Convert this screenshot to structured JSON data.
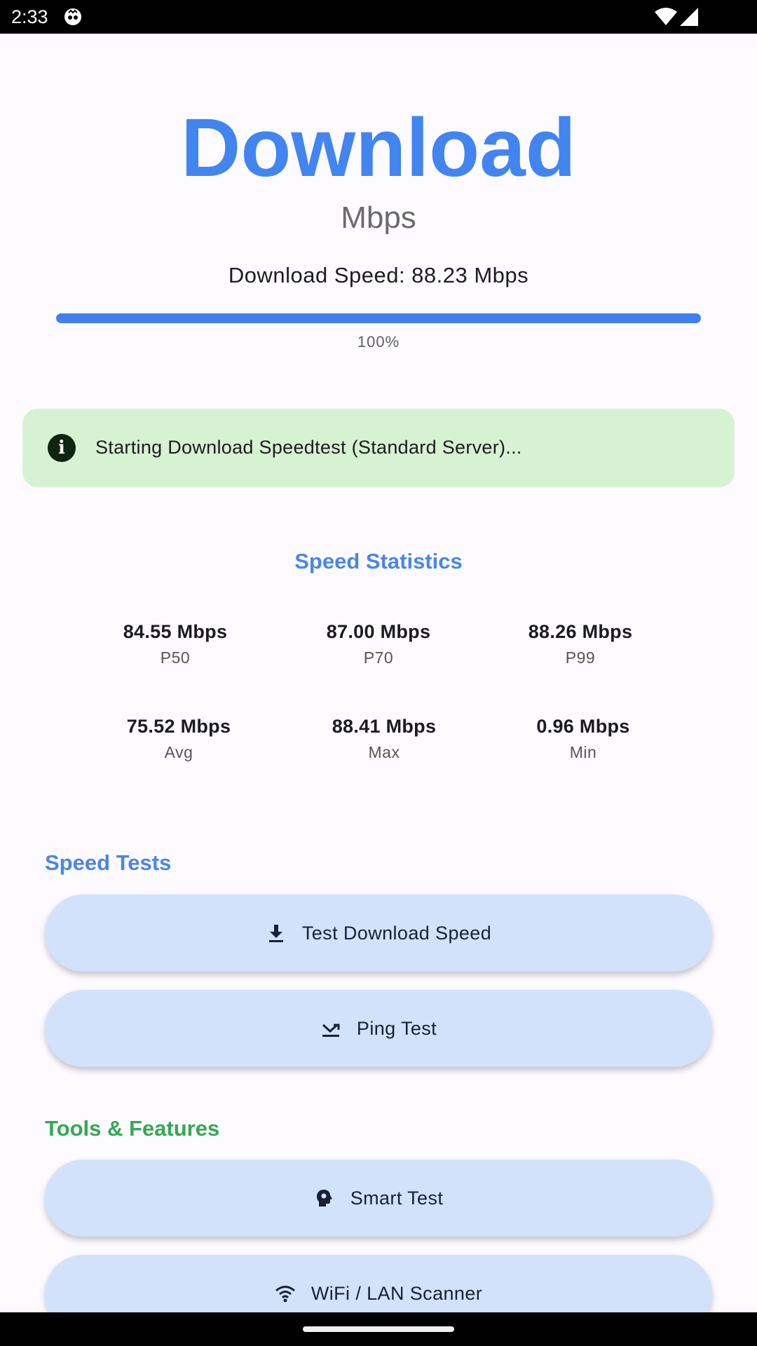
{
  "status_bar": {
    "time": "2:33",
    "icons": [
      "notification-app-icon",
      "wifi-icon",
      "cellular-signal-icon"
    ]
  },
  "hero": {
    "title": "Download",
    "unit": "Mbps",
    "speed_text": "Download Speed: 88.23 Mbps",
    "progress_percent": 100,
    "progress_label": "100%"
  },
  "info_banner": {
    "icon": "info-icon",
    "message": "Starting Download Speedtest (Standard Server)..."
  },
  "statistics": {
    "title": "Speed Statistics",
    "items": [
      {
        "value": "84.55 Mbps",
        "label": "P50"
      },
      {
        "value": "87.00 Mbps",
        "label": "P70"
      },
      {
        "value": "88.26 Mbps",
        "label": "P99"
      },
      {
        "value": "75.52 Mbps",
        "label": "Avg"
      },
      {
        "value": "88.41 Mbps",
        "label": "Max"
      },
      {
        "value": "0.96 Mbps",
        "label": "Min"
      }
    ]
  },
  "speed_tests": {
    "title": "Speed Tests",
    "buttons": [
      {
        "label": "Test Download Speed",
        "icon": "download-icon"
      },
      {
        "label": "Ping Test",
        "icon": "ping-icon"
      }
    ]
  },
  "tools": {
    "title": "Tools & Features",
    "buttons": [
      {
        "label": "Smart Test",
        "icon": "smart-head-icon"
      },
      {
        "label": "WiFi / LAN Scanner",
        "icon": "wifi-icon"
      }
    ]
  },
  "colors": {
    "accent_blue": "#4285f0",
    "tools_green": "#34a853",
    "banner_bg": "#d7f2d2",
    "button_bg": "#d3e2fb"
  }
}
